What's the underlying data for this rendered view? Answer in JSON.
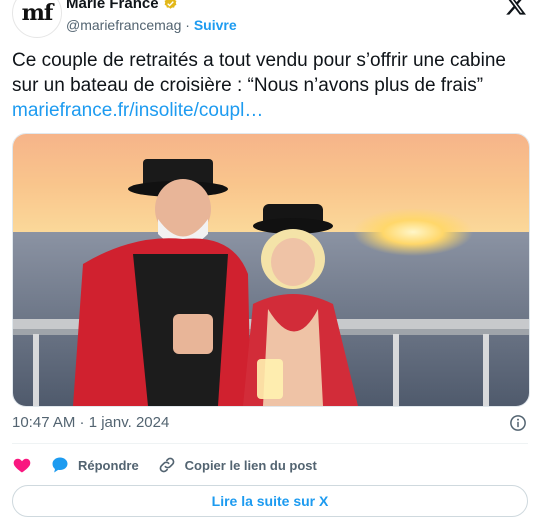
{
  "account": {
    "avatar_text": "mf",
    "name": "Marie France",
    "handle": "@mariefrancemag",
    "separator": "·",
    "follow_label": "Suivre"
  },
  "tweet": {
    "text": "Ce couple de retraités a tout vendu pour s’offrir une cabine sur un bateau de croisière : “Nous n’avons plus de frais” ",
    "link_text": "mariefrance.fr/insolite/coupl…",
    "timestamp": "10:47 AM · 1 janv. 2024"
  },
  "actions": {
    "reply_label": "Répondre",
    "copy_label": "Copier le lien du post"
  },
  "read_more_label": "Lire la suite sur X",
  "colors": {
    "accent": "#1d9bf0",
    "like": "#f91880",
    "verified": "#e2b719",
    "muted": "#536471"
  },
  "icons": {
    "verified": "verified-badge-icon",
    "logo": "x-logo-icon",
    "info": "info-icon",
    "like": "heart-icon",
    "reply": "reply-bubble-icon",
    "copy": "link-icon"
  }
}
